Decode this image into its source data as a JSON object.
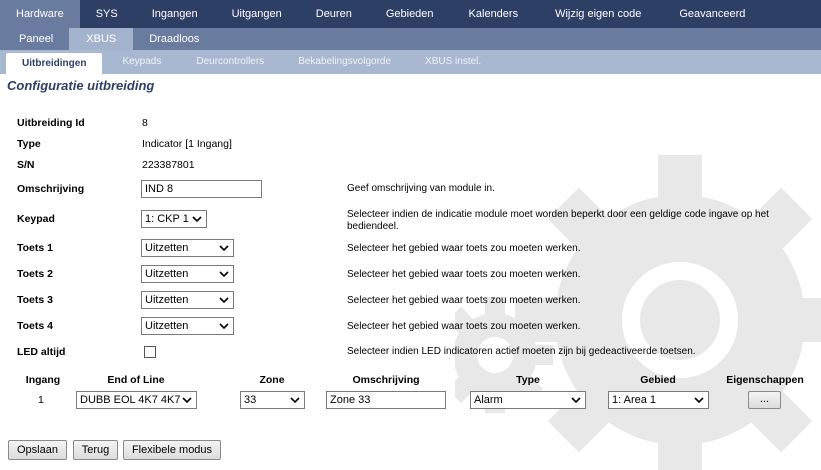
{
  "nav_main": [
    "Hardware",
    "SYS",
    "Ingangen",
    "Uitgangen",
    "Deuren",
    "Gebieden",
    "Kalenders",
    "Wijzig eigen code",
    "Geavanceerd"
  ],
  "nav_sub": [
    "Paneel",
    "XBUS",
    "Draadloos"
  ],
  "nav_tabs": [
    "Uitbreidingen",
    "Keypads",
    "Deurcontrollers",
    "Bekabelingsvolgorde",
    "XBUS instel."
  ],
  "page_title": "Configuratie uitbreiding",
  "fields": {
    "id": {
      "label": "Uitbreiding Id",
      "value": "8"
    },
    "type": {
      "label": "Type",
      "value": "Indicator [1 Ingang]"
    },
    "sn": {
      "label": "S/N",
      "value": "223387801"
    },
    "description": {
      "label": "Omschrijving",
      "value": "IND 8",
      "help": "Geef omschrijving van module in."
    },
    "keypad": {
      "label": "Keypad",
      "value": "1: CKP 1",
      "help": "Selecteer indien de indicatie module moet worden beperkt door een geldige code ingave op het bediendeel."
    },
    "key1": {
      "label": "Toets 1",
      "value": "Uitzetten",
      "help": "Selecteer het gebied waar toets zou moeten werken."
    },
    "key2": {
      "label": "Toets 2",
      "value": "Uitzetten",
      "help": "Selecteer het gebied waar toets zou moeten werken."
    },
    "key3": {
      "label": "Toets 3",
      "value": "Uitzetten",
      "help": "Selecteer het gebied waar toets zou moeten werken."
    },
    "key4": {
      "label": "Toets 4",
      "value": "Uitzetten",
      "help": "Selecteer het gebied waar toets zou moeten werken."
    },
    "led": {
      "label": "LED altijd",
      "checked": false,
      "help": "Selecteer indien LED indicatoren actief moeten zijn bij gedeactiveerde toetsen."
    }
  },
  "input_table": {
    "headers": [
      "Ingang",
      "End of Line",
      "Zone",
      "Omschrijving",
      "Type",
      "Gebied",
      "Eigenschappen"
    ],
    "row": {
      "ingang": "1",
      "eol": "DUBB EOL 4K7 4K7",
      "zone": "33",
      "description": "Zone 33",
      "type": "Alarm",
      "area": "1: Area 1",
      "props": "..."
    }
  },
  "buttons": {
    "save": "Opslaan",
    "back": "Terug",
    "flex": "Flexibele modus"
  },
  "colors": {
    "nav_dark": "#2e3f66",
    "nav_mid": "#6a7ba0",
    "nav_light": "#a9b8d1",
    "gear": "#e6e6e6"
  },
  "icons": {
    "select_arrow": "chevron-down-icon",
    "background": "gear-icon"
  }
}
